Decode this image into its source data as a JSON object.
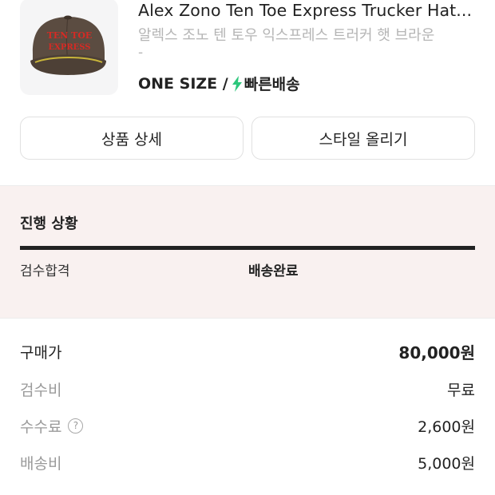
{
  "product": {
    "image_text_line1": "TEN TOE",
    "image_text_line2": "EXPRESS",
    "title": "Alex Zono Ten Toe Express Trucker Hat...",
    "subtitle": "알렉스 조노 텐 토우 익스프레스 트러커 햇 브라운",
    "option_dash": "-",
    "size": "ONE SIZE /",
    "shipping_icon": "lightning-bolt-icon",
    "shipping_label": "빠른배송",
    "shipping_color": "#2dc77c"
  },
  "actions": {
    "detail_label": "상품 상세",
    "style_label": "스타일 올리기"
  },
  "progress": {
    "title": "진행 상황",
    "steps": [
      "검수합격",
      "배송완료"
    ],
    "completed_fraction": 1.0
  },
  "payment": {
    "rows": [
      {
        "label": "구매가",
        "value": "80,000원"
      },
      {
        "label": "검수비",
        "value": "무료"
      },
      {
        "label": "수수료",
        "value": "2,600원",
        "help": "?"
      },
      {
        "label": "배송비",
        "value": "5,000원"
      }
    ]
  }
}
